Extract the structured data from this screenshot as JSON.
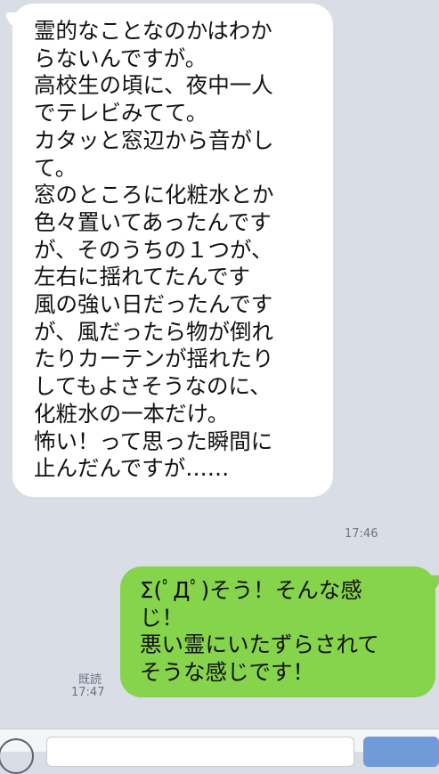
{
  "incoming": {
    "lines": [
      "霊的なことなのかはわか",
      "らないんですが。",
      "高校生の頃に、夜中一人",
      "でテレビみてて。",
      "カタッと窓辺から音がし",
      "て。",
      "窓のところに化粧水とか",
      "色々置いてあったんです",
      "が、そのうちの１つが、",
      "左右に揺れてたんです",
      "風の強い日だったんです",
      "が、風だったら物が倒れ",
      "たりカーテンが揺れたり",
      "してもよさそうなのに、",
      "化粧水の一本だけ。",
      "怖い！って思った瞬間に",
      "止んだんですが……"
    ],
    "time": "17:46"
  },
  "outgoing": {
    "lines": [
      "Σ(ﾟДﾟ)そう！そんな感",
      "じ！",
      "悪い霊にいたずらされて",
      "そうな感じです！"
    ],
    "read_label": "既読",
    "time": "17:47"
  },
  "colors": {
    "background": "#d9dde6",
    "incoming_bubble": "#ffffff",
    "outgoing_bubble": "#86d44b",
    "send_button": "#6f9bd8"
  },
  "icons": {
    "attach": "plus-circle-icon"
  }
}
